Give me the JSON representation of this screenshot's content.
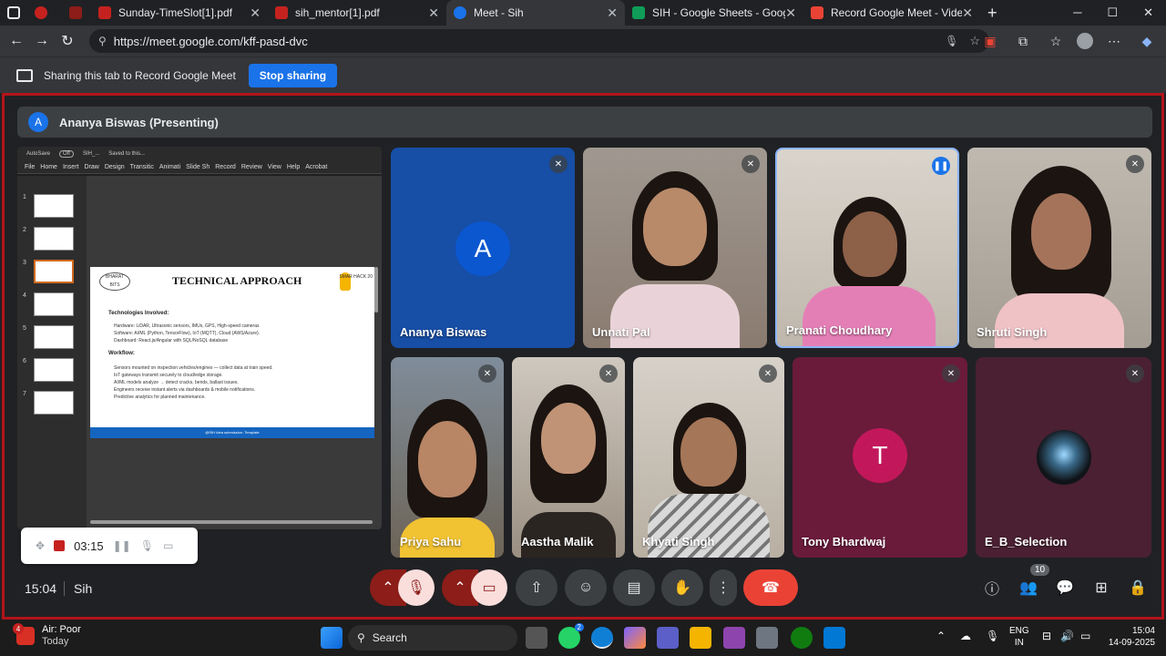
{
  "browser": {
    "tabs": [
      {
        "label": "",
        "color": "#c5221f"
      },
      {
        "label": "",
        "color": "#8c1d18"
      },
      {
        "label": "Sunday-TimeSlot[1].pdf",
        "color": "#c5221f"
      },
      {
        "label": "sih_mentor[1].pdf",
        "color": "#c5221f"
      },
      {
        "label": "Meet - Sih",
        "color": "#1a73e8"
      },
      {
        "label": "SIH - Google Sheets - Google Sh",
        "color": "#0f9d58"
      },
      {
        "label": "Record Google Meet - Video edi",
        "color": "#ea4335"
      }
    ],
    "url": "https://meet.google.com/kff-pasd-dvc"
  },
  "sharing": {
    "text": "Sharing this tab to Record Google Meet",
    "stop_label": "Stop sharing"
  },
  "presenter": {
    "initial": "A",
    "label": "Ananya Biswas (Presenting)"
  },
  "shared_screen": {
    "titlebar": [
      "AutoSave",
      "Off",
      "SIH_...",
      "Saved to this..."
    ],
    "menu": [
      "File",
      "Home",
      "Insert",
      "Draw",
      "Design",
      "Transitic",
      "Animati",
      "Slide Sh",
      "Record",
      "Review",
      "View",
      "Help",
      "Acrobat"
    ],
    "thumb_numbers": [
      "1",
      "2",
      "3",
      "4",
      "5",
      "6",
      "7"
    ],
    "slide": {
      "logo": "BHARAT BITS",
      "title": "TECHNICAL APPROACH",
      "smart": "SMAR HACK 20",
      "tech_heading": "Technologies Involved:",
      "tech_items": [
        "Hardware: LiDAR, Ultrasonic sensors, IMUs, GPS, High-speed cameras",
        "Software: AI/ML (Python, TensorFlow), IoT (MQTT), Cloud (AWS/Azure).",
        "Dashboard: React.js/Angular with SQL/NoSQL database"
      ],
      "workflow_heading": "Workflow:",
      "workflow_items": [
        "Sensors mounted on inspection vehicles/engines — collect data at train speed.",
        "IoT gateways transmit securely to cloud/edge storage.",
        "AI/ML models analyze → detect cracks, bends, ballast issues.",
        "Engineers receive instant alerts via dashboards & mobile notifications.",
        "Predictive analytics for planned maintenance."
      ],
      "footer": "@SIH Idea submission- Template"
    }
  },
  "recorder": {
    "time": "03:15"
  },
  "participants": [
    {
      "name": "Ananya Biswas",
      "initial": "A",
      "muted": true
    },
    {
      "name": "Unnati Pal",
      "muted": true
    },
    {
      "name": "Pranati Choudhary",
      "muted": false,
      "speaking": true
    },
    {
      "name": "Shruti Singh",
      "muted": true
    },
    {
      "name": "Priya Sahu",
      "muted": true
    },
    {
      "name": "Aastha Malik",
      "muted": true
    },
    {
      "name": "Khyati Singh",
      "muted": true
    },
    {
      "name": "Tony Bhardwaj",
      "initial": "T",
      "muted": true
    },
    {
      "name": "E_B_Selection",
      "muted": true
    }
  ],
  "meeting": {
    "clock": "15:04",
    "name": "Sih",
    "people_count": "10"
  },
  "taskbar": {
    "weather_badge": "4",
    "weather_title": "Air: Poor",
    "weather_sub": "Today",
    "search": "Search",
    "whatsapp_badge": "2",
    "lang1": "ENG",
    "lang2": "IN",
    "time": "15:04",
    "date": "14-09-2025"
  },
  "colors": {
    "meet_border": "#b3141b",
    "accent": "#1a73e8",
    "leave": "#ea4335"
  }
}
